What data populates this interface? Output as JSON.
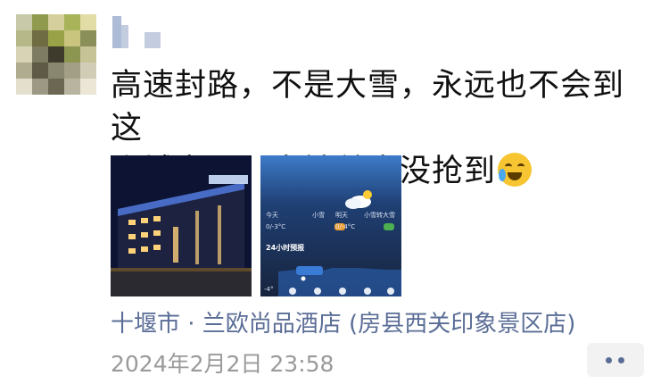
{
  "post": {
    "text_line1": "高速封路，不是大雪，永远也不会到这",
    "text_line2": "个城市吧！宾馆差点没抢到",
    "emoji": "crying-laughing-emoji"
  },
  "photos": {
    "weather": {
      "today_label": "今天",
      "today_condition": "小雪",
      "today_temp": "0/-3°C",
      "tomorrow_label": "明天",
      "tomorrow_condition": "小雪转大雪",
      "tomorrow_temp": "0/-4°C",
      "forecast_title": "24小时预报",
      "low_tick": "-4°"
    }
  },
  "location": "十堰市 · 兰欧尚品酒店 (房县西关印象景区店)",
  "timestamp": "2024年2月2日 23:58",
  "colors": {
    "link": "#5a6d96",
    "timestamp": "#9a9a9a",
    "text": "#111111"
  }
}
